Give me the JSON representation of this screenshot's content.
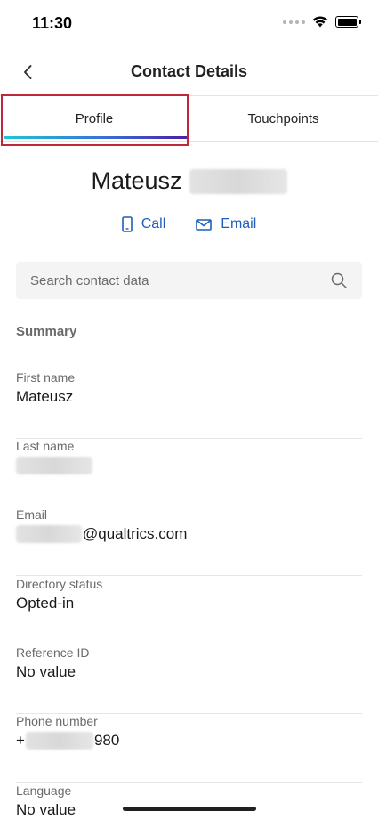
{
  "status_bar": {
    "time": "11:30"
  },
  "nav": {
    "title": "Contact Details"
  },
  "tabs": [
    {
      "label": "Profile"
    },
    {
      "label": "Touchpoints"
    }
  ],
  "contact": {
    "first_name": "Mateusz"
  },
  "actions": {
    "call_label": "Call",
    "email_label": "Email"
  },
  "search": {
    "placeholder": "Search contact data",
    "value": ""
  },
  "summary": {
    "title": "Summary",
    "fields": [
      {
        "label": "First name",
        "value": "Mateusz"
      },
      {
        "label": "Last name",
        "value": ""
      },
      {
        "label": "Email",
        "value_suffix": "@qualtrics.com"
      },
      {
        "label": "Directory status",
        "value": "Opted-in"
      },
      {
        "label": "Reference ID",
        "value": "No value"
      },
      {
        "label": "Phone number",
        "value_prefix": "+",
        "value_suffix": "980"
      },
      {
        "label": "Language",
        "value": "No value"
      }
    ]
  },
  "colors": {
    "accent": "#1f5fb8",
    "highlight": "#c0283a",
    "tab_gradient_start": "#21c7d3",
    "tab_gradient_end": "#4b1fa8"
  }
}
